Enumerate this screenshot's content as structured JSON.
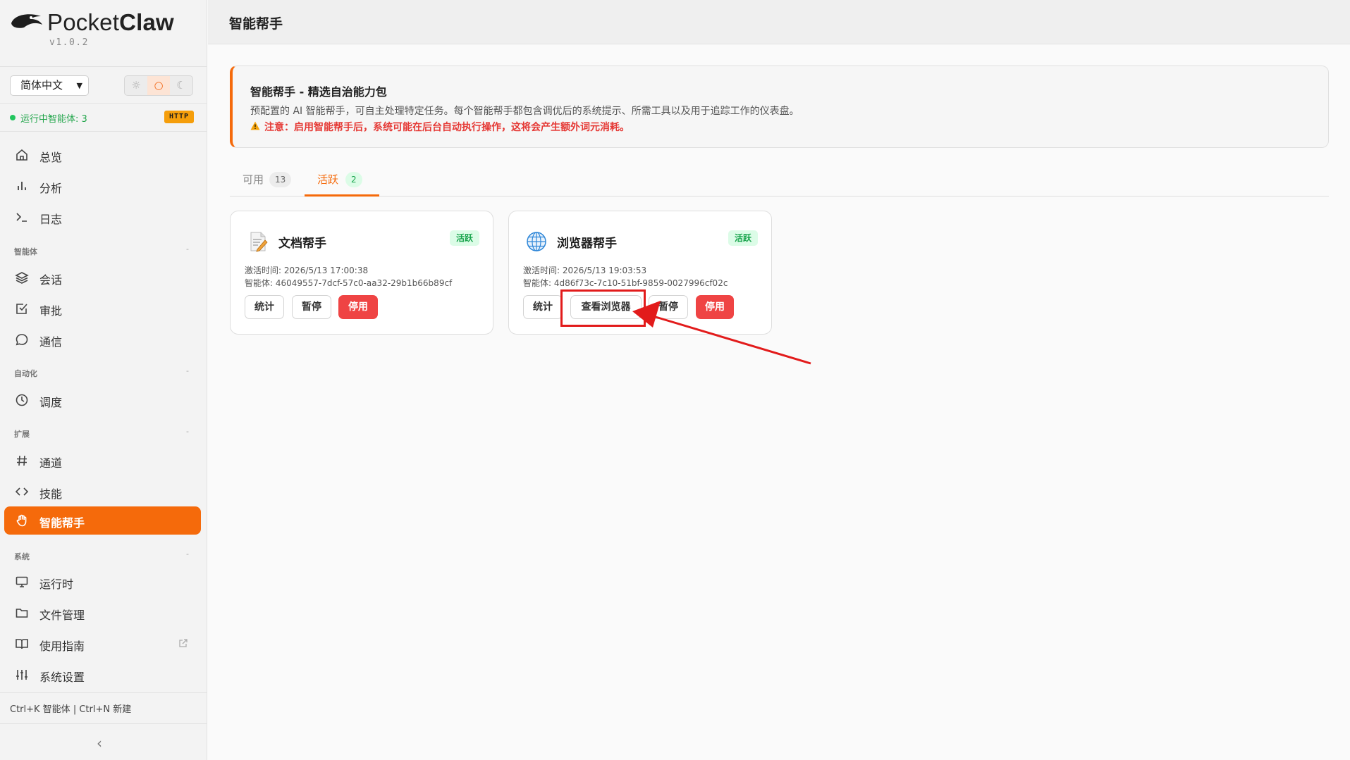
{
  "brand": {
    "name_light": "Pocket",
    "name_bold": "Claw",
    "version": "v1.0.2"
  },
  "controls": {
    "language": "简体中文",
    "theme_options": [
      "☼",
      "○",
      "☾"
    ]
  },
  "status": {
    "running_text": "运行中智能体: 3",
    "protocol_badge": "HTTP"
  },
  "nav": {
    "overview": "总览",
    "analytics": "分析",
    "logs": "日志",
    "section_agents": "智能体",
    "sessions": "会话",
    "approvals": "审批",
    "messaging": "通信",
    "section_automation": "自动化",
    "scheduling": "调度",
    "section_extensions": "扩展",
    "channels": "通道",
    "skills": "技能",
    "assistants": "智能帮手",
    "section_system": "系统",
    "runtime": "运行时",
    "files": "文件管理",
    "guide": "使用指南",
    "settings": "系统设置",
    "section_collapse": "-"
  },
  "shortcut_hint": "Ctrl+K 智能体 | Ctrl+N 新建",
  "collapse_glyph": "‹",
  "page": {
    "title": "智能帮手"
  },
  "banner": {
    "title": "智能帮手 - 精选自治能力包",
    "description": "预配置的 AI 智能帮手，可自主处理特定任务。每个智能帮手都包含调优后的系统提示、所需工具以及用于追踪工作的仪表盘。",
    "warning": "注意：启用智能帮手后，系统可能在后台自动执行操作，这将会产生额外词元消耗。"
  },
  "tabs": {
    "available": {
      "label": "可用",
      "count": "13"
    },
    "active": {
      "label": "活跃",
      "count": "2"
    }
  },
  "cards": [
    {
      "name": "文档帮手",
      "badge": "活跃",
      "icon": "document-edit-icon",
      "activated": "激活时间:  2026/5/13 17:00:38",
      "agent": "智能体:  46049557-7dcf-57c0-aa32-29b1b66b89cf",
      "buttons": [
        "统计",
        "暂停",
        "停用"
      ]
    },
    {
      "name": "浏览器帮手",
      "badge": "活跃",
      "icon": "globe-icon",
      "activated": "激活时间:  2026/5/13 19:03:53",
      "agent": "智能体:  4d86f73c-7c10-51bf-9859-0027996cf02c",
      "buttons": [
        "统计",
        "查看浏览器",
        "暂停",
        "停用"
      ]
    }
  ],
  "colors": {
    "accent": "#f56a0b",
    "danger": "#ef4444",
    "success": "#16a34a",
    "annotation": "#e21b1b"
  }
}
